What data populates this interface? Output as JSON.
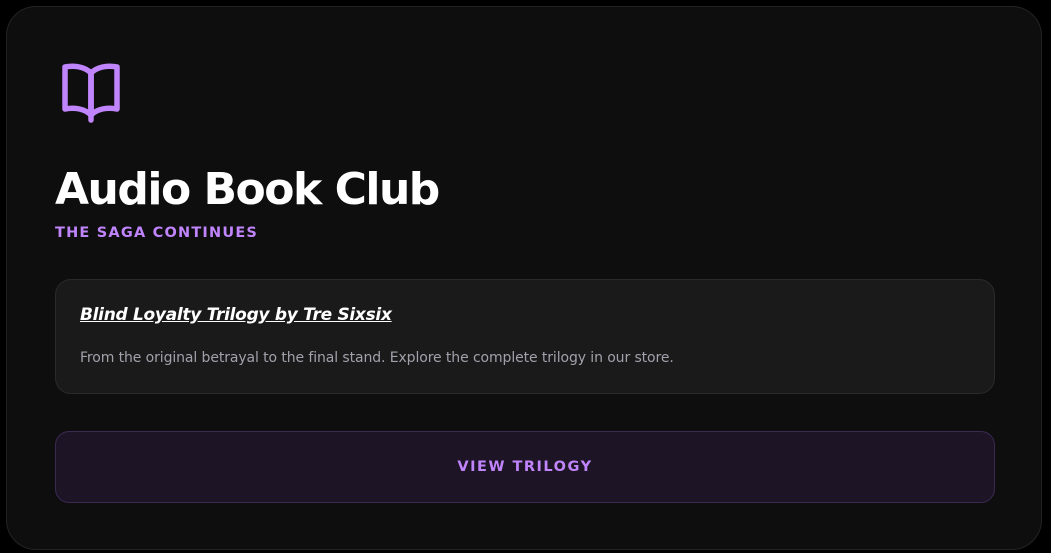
{
  "card": {
    "icon": "book-open-icon",
    "title": "Audio Book Club",
    "subtitle": "THE SAGA CONTINUES",
    "info": {
      "link_text": "Blind Loyalty Trilogy by Tre Sixsix",
      "description": "From the original betrayal to the final stand. Explore the complete trilogy in our store."
    },
    "cta_label": "VIEW TRILOGY"
  },
  "colors": {
    "accent": "#c084fc",
    "card_background": "#0e0e0f",
    "info_background": "#1a1a1b",
    "cta_background": "#1d1526"
  }
}
